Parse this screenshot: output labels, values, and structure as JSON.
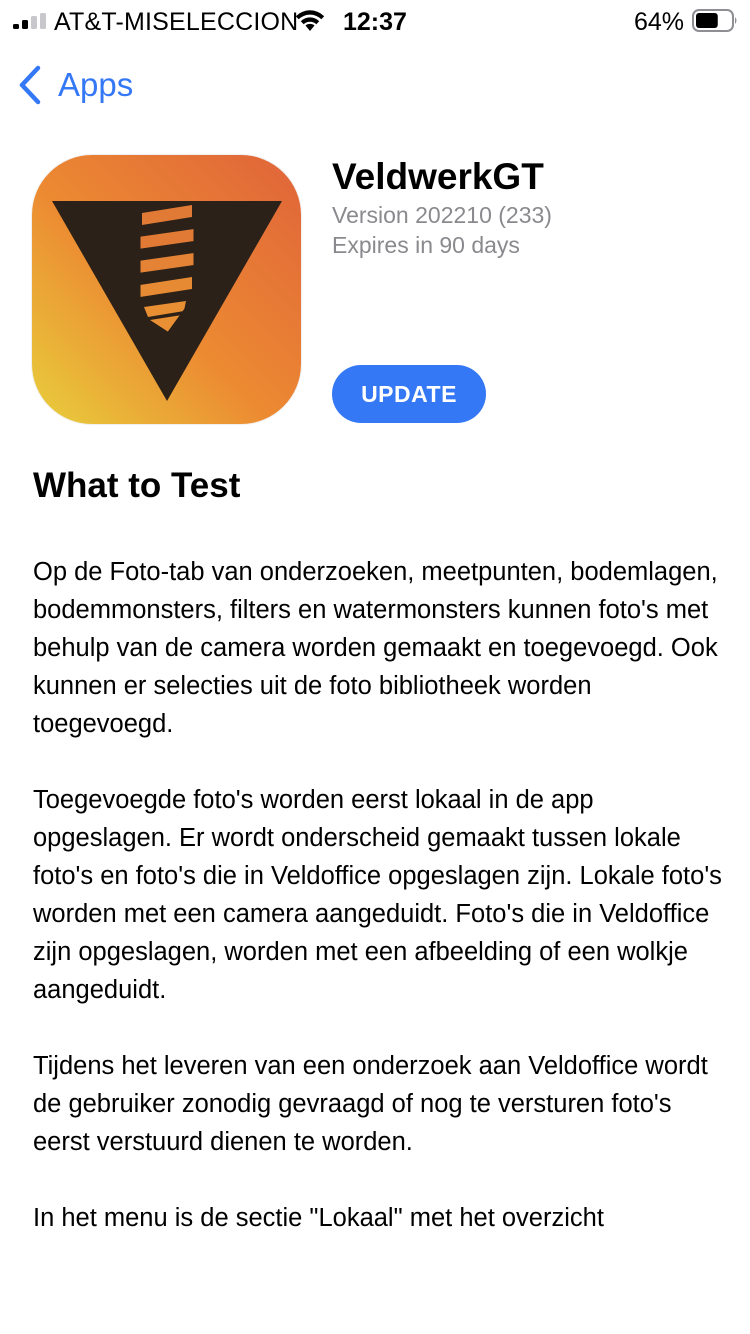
{
  "status_bar": {
    "carrier": "AT&T-MISELECCION",
    "time": "12:37",
    "battery_percent": "64%",
    "battery_level": 0.64,
    "signal_bars_filled": 2,
    "signal_bars_total": 4
  },
  "nav": {
    "back_label": "Apps"
  },
  "app": {
    "name": "VeldwerkGT",
    "version": "Version 202210 (233)",
    "expiry": "Expires in 90 days",
    "update_label": "UPDATE"
  },
  "whats_new": {
    "title": "What to Test",
    "paragraphs": [
      "Op de Foto-tab van onderzoeken, meetpunten, bodemlagen, bodemmonsters, filters en watermonsters kunnen foto's met behulp van de camera worden gemaakt en toegevoegd. Ook kunnen er selecties uit de foto bibliotheek worden toegevoegd.",
      "Toegevoegde foto's worden eerst lokaal in de app opgeslagen. Er wordt onderscheid gemaakt tussen lokale foto's en foto's die in Veldoffice opgeslagen zijn. Lokale foto's worden met een camera aangeduidt. Foto's die in Veldoffice zijn opgeslagen, worden met een afbeelding of een wolkje aangeduidt.",
      "Tijdens het leveren van een onderzoek aan Veldoffice wordt de gebruiker zonodig gevraagd of nog te versturen foto's eerst verstuurd dienen te worden.",
      "In het menu is de sectie \"Lokaal\" met het overzicht"
    ]
  },
  "colors": {
    "accent": "#3478f6",
    "secondary_text": "#8a8a8e",
    "icon_orange": "#e8752f",
    "icon_yellow": "#e8c53a",
    "icon_dark": "#2b2118"
  }
}
